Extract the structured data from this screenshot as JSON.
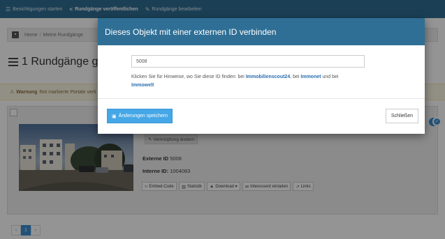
{
  "topnav": {
    "items": [
      {
        "label": "Besichtigungen starten",
        "icon": "bars-icon"
      },
      {
        "label": "Rundgänge veröffentlichen",
        "icon": "share-icon"
      },
      {
        "label": "Rundgänge bearbeiten",
        "icon": "pencil-icon"
      }
    ]
  },
  "breadcrumb": {
    "items": [
      "Home",
      "Meine Rundgänge"
    ]
  },
  "page": {
    "heading": "1 Rundgänge gefund"
  },
  "warning": {
    "label": "Warnung",
    "text": "Rot markierte Portale verli"
  },
  "card": {
    "verknuepfung_btn": "Verknüpfung ändern",
    "external_id_label": "Externe ID",
    "external_id_value": "5008",
    "internal_id_label": "Interne ID:",
    "internal_id_value": "1004083",
    "actions": [
      {
        "label": "Embed-Code",
        "icon": "code-icon"
      },
      {
        "label": "Statistik",
        "icon": "chart-icon"
      },
      {
        "label": "Download ▾",
        "icon": "user-icon"
      },
      {
        "label": "Interessent einladen",
        "icon": "envelope-icon"
      },
      {
        "label": "Links",
        "icon": "external-link-icon"
      }
    ]
  },
  "pager": {
    "prev": "‹",
    "page": "1",
    "next": "›"
  },
  "modal": {
    "title": "Dieses Objekt mit einer externen ID verbinden",
    "input_value": "5008",
    "hint_prefix": "Klicken Sie für Hinweise, wo Sie diese ID finden: bei ",
    "link_immoscout": "Immobilienscout24",
    "hint_mid1": ", bei ",
    "link_immonet": "Immonet",
    "hint_mid2": " und bei ",
    "link_immowelt": "Immowelt",
    "save_label": "Änderungen speichern",
    "close_label": "Schließen"
  },
  "colors": {
    "header_blue": "#2f6f95",
    "primary_button": "#46a7e6",
    "link": "#2a6fb0",
    "warning_bg": "#fcf8e3"
  }
}
